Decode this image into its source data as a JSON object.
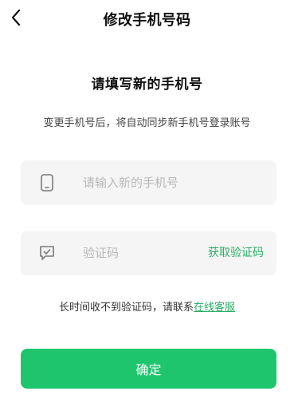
{
  "header": {
    "title": "修改手机号码",
    "back_icon": "chevron-left-icon"
  },
  "main": {
    "heading": "请填写新的手机号",
    "subtitle": "变更手机号后，将自动同步新手机号登录账号"
  },
  "phone_field": {
    "icon": "phone-icon",
    "placeholder": "请输入新的手机号",
    "value": ""
  },
  "code_field": {
    "icon": "message-check-icon",
    "placeholder": "验证码",
    "value": "",
    "get_code_label": "获取验证码"
  },
  "help": {
    "text": "长时间收不到验证码，请联系",
    "link": "在线客服"
  },
  "confirm_label": "确定",
  "colors": {
    "accent": "#2aae67",
    "button": "#1fc56d",
    "field_background": "#f5f5f6"
  }
}
